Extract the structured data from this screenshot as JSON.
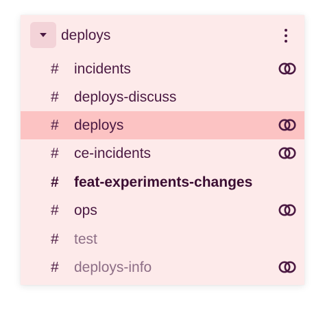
{
  "section": {
    "title": "deploys",
    "toggle_icon": "caret-down-icon",
    "menu_icon": "kebab-menu-icon"
  },
  "channels": [
    {
      "name": "incidents",
      "shared": true,
      "selected": false,
      "unread": false,
      "muted": false
    },
    {
      "name": "deploys-discuss",
      "shared": false,
      "selected": false,
      "unread": false,
      "muted": false
    },
    {
      "name": "deploys",
      "shared": true,
      "selected": true,
      "unread": false,
      "muted": false
    },
    {
      "name": "ce-incidents",
      "shared": true,
      "selected": false,
      "unread": false,
      "muted": false
    },
    {
      "name": "feat-experiments-changes",
      "shared": false,
      "selected": false,
      "unread": true,
      "muted": false
    },
    {
      "name": "ops",
      "shared": true,
      "selected": false,
      "unread": false,
      "muted": false
    },
    {
      "name": "test",
      "shared": false,
      "selected": false,
      "unread": false,
      "muted": true
    },
    {
      "name": "deploys-info",
      "shared": true,
      "selected": false,
      "unread": false,
      "muted": true
    }
  ],
  "hash_symbol": "#",
  "colors": {
    "panel_bg": "#fdeaea",
    "selected_bg": "#fcc3c3",
    "text": "#4a1942",
    "muted_text": "#8d6e86"
  }
}
